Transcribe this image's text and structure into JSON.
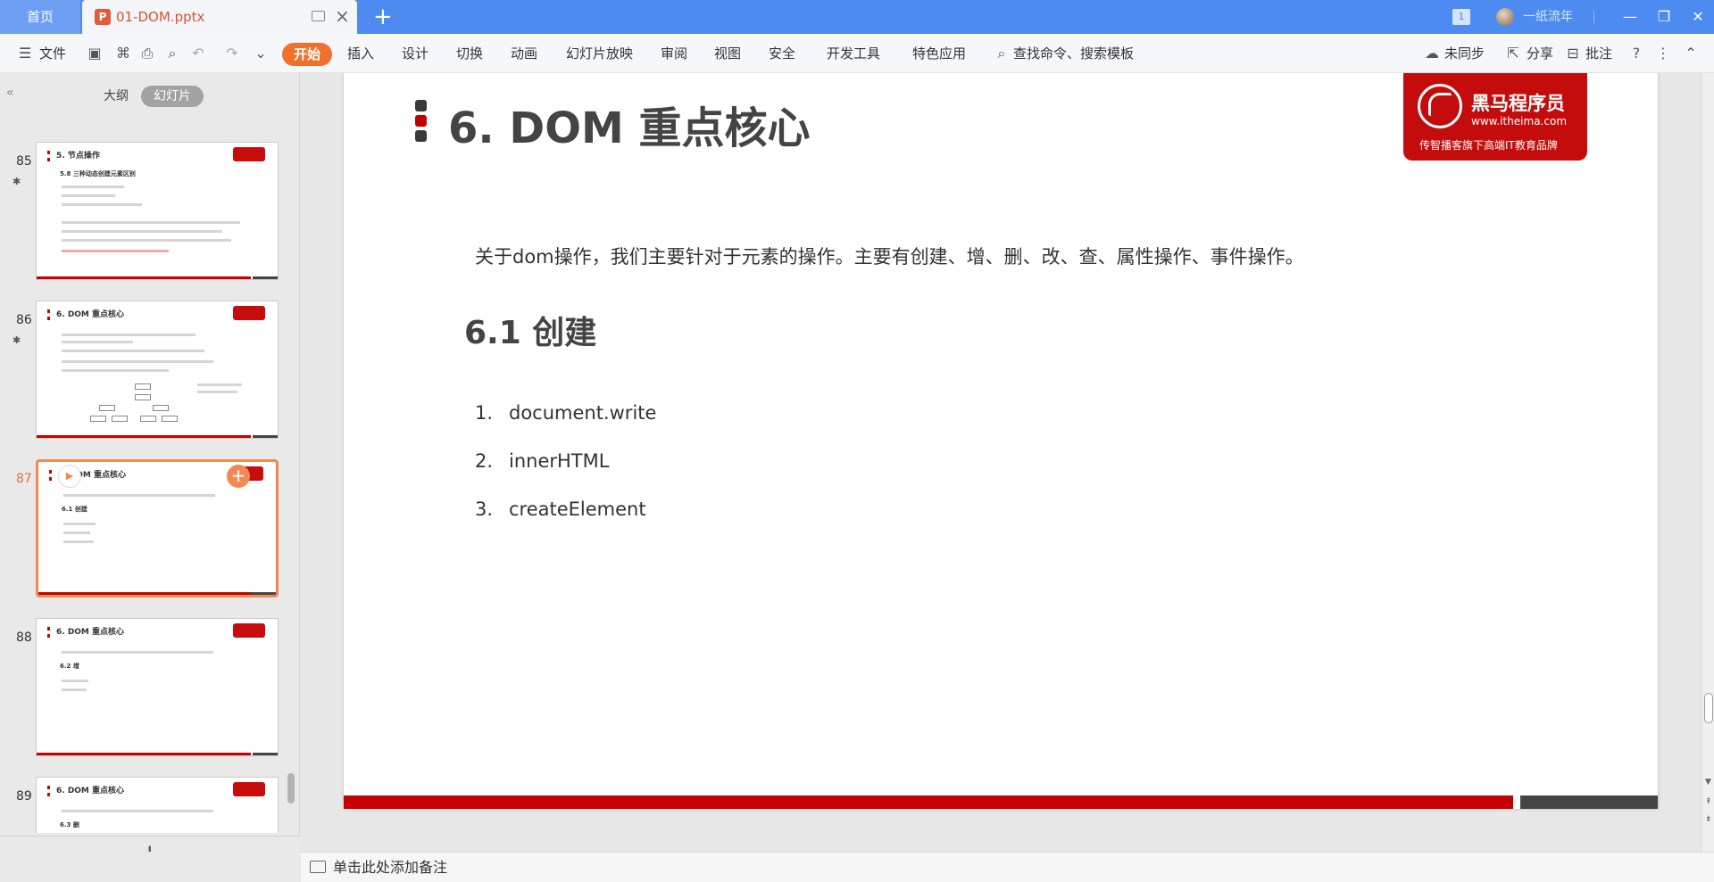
{
  "titlebar": {
    "home_tab": "首页",
    "doc_tab": "01-DOM.pptx",
    "new_tab_icon": "plus-icon",
    "badge": "1",
    "user_name": "一纸流年",
    "colors": {
      "bar": "#4d8bf0",
      "doc_tab_text": "#d8532d"
    }
  },
  "ribbon": {
    "file_menu": "文件",
    "tabs": [
      "开始",
      "插入",
      "设计",
      "切换",
      "动画",
      "幻灯片放映",
      "审阅",
      "视图",
      "安全",
      "开发工具",
      "特色应用"
    ],
    "search": "查找命令、搜索模板",
    "sync": "未同步",
    "share": "分享",
    "comment": "批注",
    "accent": "#f0712e"
  },
  "left_panel": {
    "view_outline": "大纲",
    "view_slides": "幻灯片",
    "slides": [
      {
        "number": "85",
        "title": "5. 节点操作",
        "subtitle": "5.8 三种动态创建元素区别",
        "active": false
      },
      {
        "number": "86",
        "title": "6. DOM 重点核心",
        "subtitle": "",
        "active": false
      },
      {
        "number": "87",
        "title": "6. DOM 重点核心",
        "subtitle": "6.1 创建",
        "active": true
      },
      {
        "number": "88",
        "title": "6. DOM 重点核心",
        "subtitle": "6.2 增",
        "active": false
      },
      {
        "number": "89",
        "title": "6. DOM 重点核心",
        "subtitle": "6.3 删",
        "active": false
      }
    ]
  },
  "slide": {
    "title": "6. DOM 重点核心",
    "logo_cn": "黑马程序员",
    "logo_url": "www.itheima.com",
    "logo_sub": "传智播客旗下高端IT教育品牌",
    "intro": "关于dom操作，我们主要针对于元素的操作。主要有创建、增、删、改、查、属性操作、事件操作。",
    "section_heading": "6.1 创建",
    "list": [
      {
        "n": "1.",
        "text": "document.write"
      },
      {
        "n": "2.",
        "text": "innerHTML"
      },
      {
        "n": "3.",
        "text": "createElement"
      }
    ],
    "colors": {
      "brand_red": "#c40000",
      "bar_dark": "#444444"
    }
  },
  "notes": {
    "placeholder": "单击此处添加备注"
  }
}
